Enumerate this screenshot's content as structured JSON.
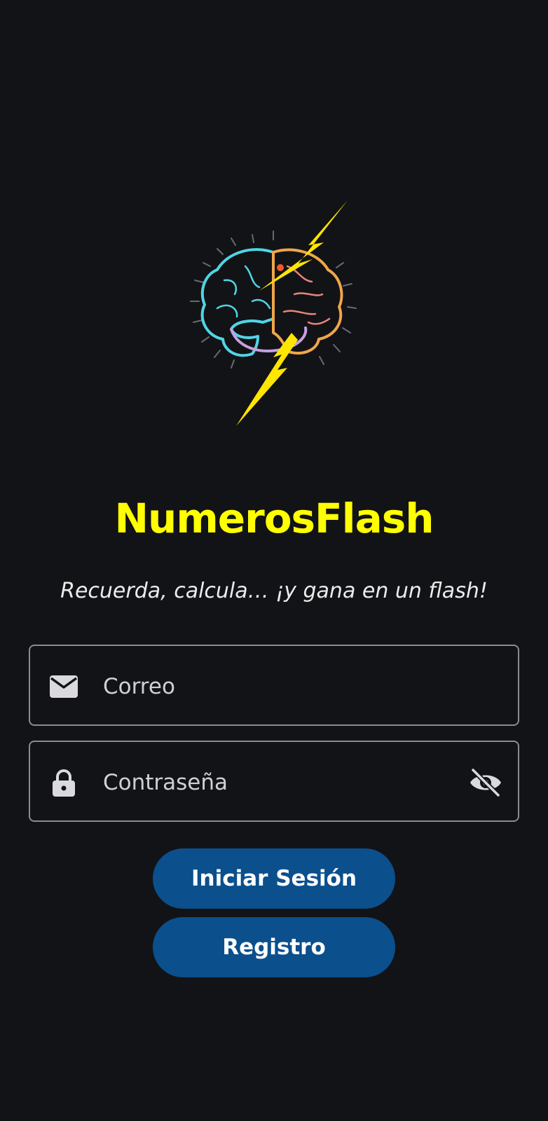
{
  "app": {
    "title": "NumerosFlash",
    "tagline": "Recuerda, calcula… ¡y gana en un flash!"
  },
  "form": {
    "email": {
      "placeholder": "Correo",
      "value": "",
      "icon": "mail-icon"
    },
    "password": {
      "placeholder": "Contraseña",
      "value": "",
      "icon": "lock-icon",
      "toggle_icon": "eye-off-icon"
    }
  },
  "buttons": {
    "login_label": "Iniciar Sesión",
    "register_label": "Registro"
  },
  "colors": {
    "background": "#121316",
    "title": "#ffff00",
    "button": "#0b4f8c",
    "field_border": "#8a8c90"
  }
}
